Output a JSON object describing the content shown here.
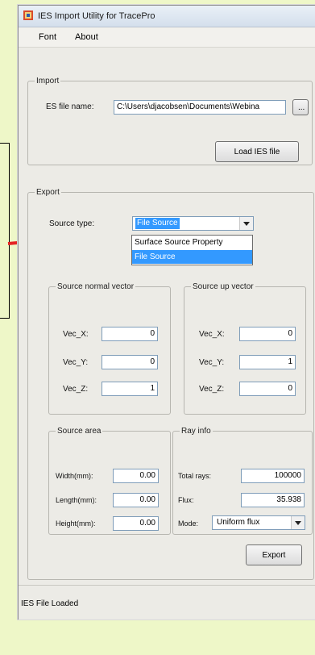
{
  "window": {
    "title": "IES Import Utility for TracePro"
  },
  "menu": {
    "font": "Font",
    "about": "About"
  },
  "import_group": {
    "legend": "Import",
    "file_label": "ES file name:",
    "file_value": "C:\\Users\\djacobsen\\Documents\\Webina",
    "browse_label": "...",
    "load_label": "Load IES file"
  },
  "export_group": {
    "legend": "Export",
    "source_type_label": "Source type:",
    "source_type_selected": "File Source",
    "source_type_options": [
      "Surface Source Property",
      "File Source"
    ]
  },
  "normal_vector": {
    "legend": "Source normal vector",
    "rows": [
      {
        "label": "Vec_X:",
        "value": "0"
      },
      {
        "label": "Vec_Y:",
        "value": "0"
      },
      {
        "label": "Vec_Z:",
        "value": "1"
      }
    ]
  },
  "up_vector": {
    "legend": "Source up vector",
    "rows": [
      {
        "label": "Vec_X:",
        "value": "0"
      },
      {
        "label": "Vec_Y:",
        "value": "1"
      },
      {
        "label": "Vec_Z:",
        "value": "0"
      }
    ]
  },
  "source_area": {
    "legend": "Source area",
    "rows": [
      {
        "label": "Width(mm):",
        "value": "0.00"
      },
      {
        "label": "Length(mm):",
        "value": "0.00"
      },
      {
        "label": "Height(mm):",
        "value": "0.00"
      }
    ]
  },
  "ray_info": {
    "legend": "Ray info",
    "total_rays_label": "Total rays:",
    "total_rays_value": "100000",
    "flux_label": "Flux:",
    "flux_value": "35.938",
    "mode_label": "Mode:",
    "mode_value": "Uniform flux"
  },
  "export_button": "Export",
  "status": "IES File Loaded",
  "colors": {
    "annotation_arrow": "#e52424",
    "selection": "#3399ff"
  }
}
